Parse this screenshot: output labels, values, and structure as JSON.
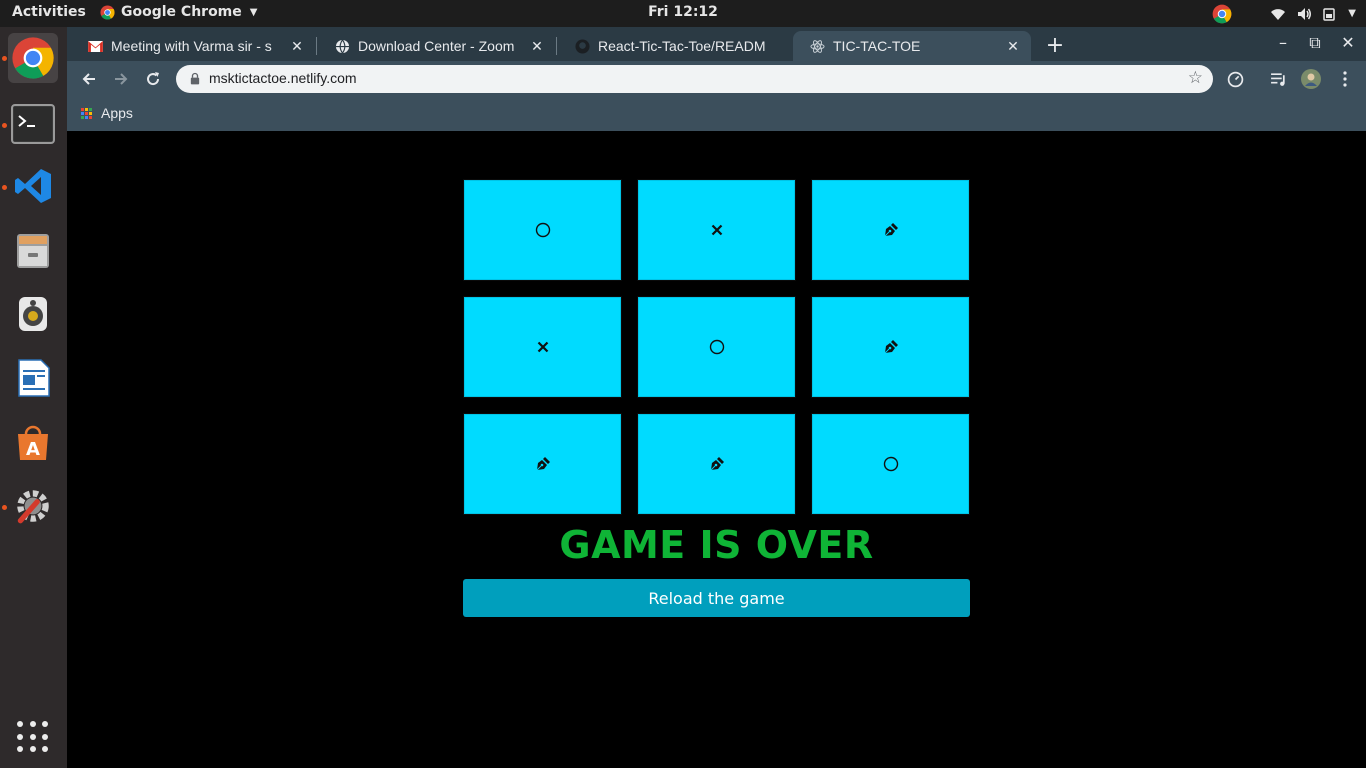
{
  "topbar": {
    "activities": "Activities",
    "app_name": "Google Chrome",
    "clock": "Fri 12:12"
  },
  "dock": {
    "items": [
      "chrome-icon",
      "terminal-icon",
      "vscode-icon",
      "files-icon",
      "rhythmbox-icon",
      "libreoffice-writer-icon",
      "software-center-icon",
      "settings-icon",
      "show-applications-icon"
    ]
  },
  "browser": {
    "tabs": [
      {
        "title": "Meeting with Varma sir - s",
        "icon": "gmail-icon"
      },
      {
        "title": "Download Center - Zoom",
        "icon": "globe-icon"
      },
      {
        "title": "React-Tic-Tac-Toe/READM",
        "icon": "github-icon"
      },
      {
        "title": "TIC-TAC-TOE",
        "icon": "react-icon",
        "active": true
      }
    ],
    "url": "msktictactoe.netlify.com",
    "bookmarks": {
      "apps_label": "Apps"
    }
  },
  "game": {
    "board": [
      "circle",
      "cross",
      "pen",
      "cross",
      "circle",
      "pen",
      "pen",
      "pen",
      "circle"
    ],
    "status": "GAME IS OVER",
    "reload_label": "Reload the game"
  },
  "colors": {
    "cell": "#00dbff",
    "status": "#0fb436",
    "button": "#009fbd",
    "page_bg": "#000000"
  }
}
